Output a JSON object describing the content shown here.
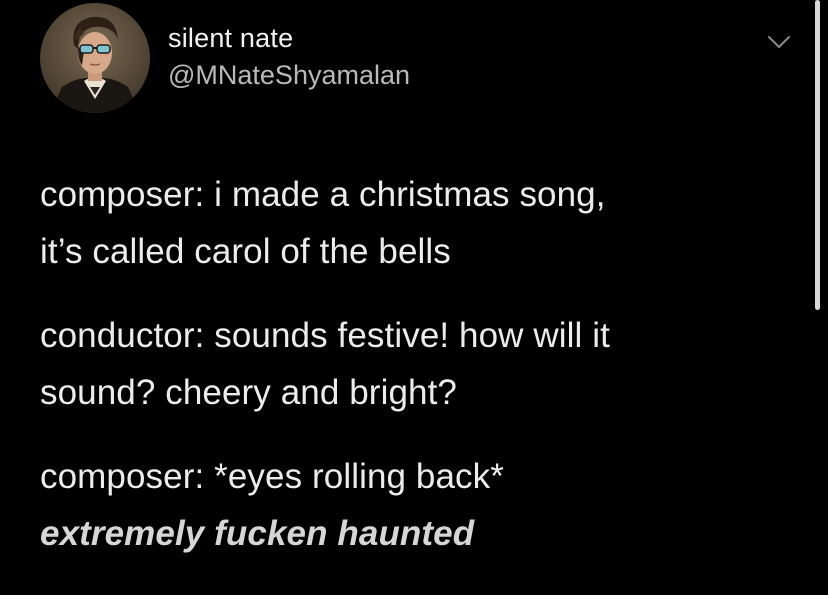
{
  "author": {
    "display_name": "silent nate",
    "handle": "@MNateShyamalan",
    "avatar_icon": "portrait-avatar-with-sunglasses"
  },
  "menu": {
    "icon": "chevron-down-icon"
  },
  "tweet": {
    "paragraphs": [
      {
        "lines": [
          "composer: i made a christmas song,",
          "it’s called carol of the bells"
        ]
      },
      {
        "lines": [
          "conductor: sounds festive! how will it",
          "sound? cheery and bright?"
        ]
      },
      {
        "lines": [
          "composer: *eyes rolling back*"
        ],
        "emphasis": "extremely fucken haunted"
      }
    ]
  },
  "colors": {
    "background": "#000000",
    "text": "#ececec",
    "secondary_text": "#b9b9b9"
  }
}
